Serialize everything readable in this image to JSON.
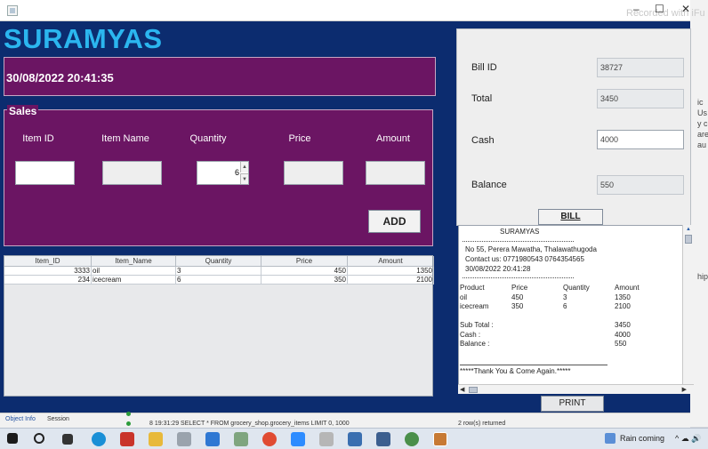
{
  "window": {
    "watermark": "Recorded with iFu",
    "minimize": "–",
    "maximize": "☐",
    "close": "✕"
  },
  "header": {
    "brand": "SURAMYAS",
    "datetime": "30/08/2022 20:41:35"
  },
  "sales": {
    "legend": "Sales",
    "labels": {
      "item_id": "Item ID",
      "item_name": "Item Name",
      "quantity": "Quantity",
      "price": "Price",
      "amount": "Amount"
    },
    "quantity_value": "6",
    "add_label": "ADD"
  },
  "table": {
    "columns": [
      "Item_ID",
      "Item_Name",
      "Quantity",
      "Price",
      "Amount"
    ],
    "rows": [
      [
        "3333",
        "oil",
        "3",
        "450",
        "1350"
      ],
      [
        "234",
        "icecream",
        "6",
        "350",
        "2100"
      ]
    ]
  },
  "bill": {
    "bill_id_label": "Bill ID",
    "bill_id": "38727",
    "total_label": "Total",
    "total": "3450",
    "cash_label": "Cash",
    "cash": "4000",
    "balance_label": "Balance",
    "balance": "550",
    "bill_button": "BILL"
  },
  "receipt": {
    "shop": "SURAMYAS",
    "address": "No 55, Perera Mawatha, Thalawathugoda",
    "contact": "Contact us: 0771980543 0764354565",
    "datetime": "30/08/2022 20:41:28",
    "headers": [
      "Product",
      "Price",
      "Quantity",
      "Amount"
    ],
    "items": [
      [
        "oil",
        "450",
        "3",
        "1350"
      ],
      [
        "icecream",
        "350",
        "6",
        "2100"
      ]
    ],
    "subtotal_label": "Sub Total :",
    "subtotal": "3450",
    "cash_label": "Cash :",
    "cash": "4000",
    "balance_label": "Balance :",
    "balance": "550",
    "thanks": "*****Thank You & Come Again.*****",
    "print_button": "PRINT"
  },
  "ide": {
    "tab1": "Object Info",
    "tab2": "Session",
    "log": "8  19:31:29  SELECT * FROM grocery_shop.grocery_items LIMIT 0, 1000",
    "result": "2 row(s) returned"
  },
  "taskbar": {
    "notification": "Rain coming",
    "tray_symbols": "^  ☁  🔊"
  },
  "side_texts": [
    "ic",
    "Us",
    "y c",
    "are",
    "au",
    "hip"
  ]
}
